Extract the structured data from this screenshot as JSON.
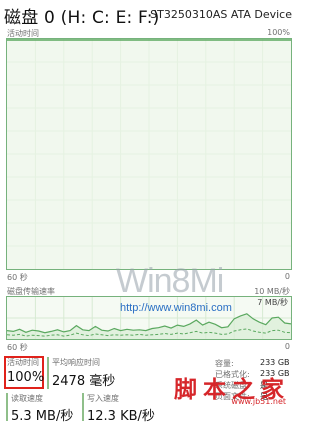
{
  "header": {
    "title": "磁盘 0 (H: C: E: F:)",
    "model": "ST3250310AS ATA Device"
  },
  "activity_chart": {
    "label": "活动时间",
    "max_label": "100%",
    "time_label": "60 秒",
    "min_label": "0"
  },
  "transfer_chart": {
    "label": "磁盘传输速率",
    "max_label": "10 MB/秒",
    "secondary_label": "7 MB/秒",
    "time_label": "60 秒",
    "min_label": "0"
  },
  "stats": {
    "active_time": {
      "label": "活动时间",
      "value": "100%"
    },
    "response_time": {
      "label": "平均响应时间",
      "value": "2478 毫秒"
    },
    "read_speed": {
      "label": "读取速度",
      "value": "5.3 MB/秒"
    },
    "write_speed": {
      "label": "写入速度",
      "value": "12.3 KB/秒"
    }
  },
  "info": {
    "capacity": {
      "label": "容量:",
      "value": "233 GB"
    },
    "formatted": {
      "label": "已格式化:",
      "value": "233 GB"
    },
    "system_disk": {
      "label": "系统磁盘:",
      "value": "是"
    },
    "page_file": {
      "label": "页面文件:",
      "value": "是"
    }
  },
  "watermarks": {
    "logo": "Win8Mi",
    "url": "http://www.win8mi.com",
    "cn_site": "脚本之家",
    "cn_url": "www.jb51.net"
  },
  "colors": {
    "chart_border": "#76b27c",
    "chart_fill": "#f5faf3",
    "grid": "#d7ead3",
    "line": "#5aa85f",
    "highlight": "#e0221b"
  },
  "chart_data": [
    {
      "type": "area",
      "name": "活动时间",
      "ylim": [
        0,
        100
      ],
      "x_span_seconds": 60,
      "values": [
        100,
        100,
        100,
        100,
        100,
        100,
        100,
        100,
        100,
        100,
        100,
        100
      ]
    },
    {
      "type": "line",
      "name": "磁盘传输速率",
      "ylim": [
        0,
        10
      ],
      "y_unit": "MB/秒",
      "x_span_seconds": 60,
      "series": [
        {
          "values": [
            2.0,
            1.8,
            2.3,
            1.6,
            2.1,
            1.9,
            1.5,
            1.8,
            2.2,
            1.7,
            2.0,
            3.2,
            2.2,
            2.0,
            3.0,
            2.1,
            1.9,
            2.5,
            2.0,
            2.3,
            2.1,
            2.2,
            2.0,
            2.5,
            2.7,
            3.1,
            2.6,
            3.3,
            3.0,
            3.6,
            4.5,
            3.3,
            4.0,
            3.5,
            2.7,
            2.9,
            4.8,
            5.5,
            6.0,
            4.8,
            4.0,
            3.4,
            5.0,
            5.2,
            3.8,
            3.6
          ]
        },
        {
          "values": [
            1.0,
            0.9,
            1.1,
            0.7,
            0.9,
            0.8,
            0.7,
            0.9,
            1.0,
            0.7,
            0.9,
            1.4,
            1.0,
            0.8,
            1.2,
            1.0,
            0.8,
            1.0,
            0.9,
            1.0,
            0.9,
            1.1,
            0.9,
            1.0,
            1.1,
            1.3,
            1.1,
            1.4,
            1.2,
            1.5,
            1.8,
            1.4,
            1.6,
            1.4,
            1.1,
            1.2,
            1.9,
            2.2,
            2.4,
            1.9,
            1.6,
            1.4,
            2.0,
            2.1,
            1.6,
            1.5
          ]
        }
      ]
    }
  ]
}
